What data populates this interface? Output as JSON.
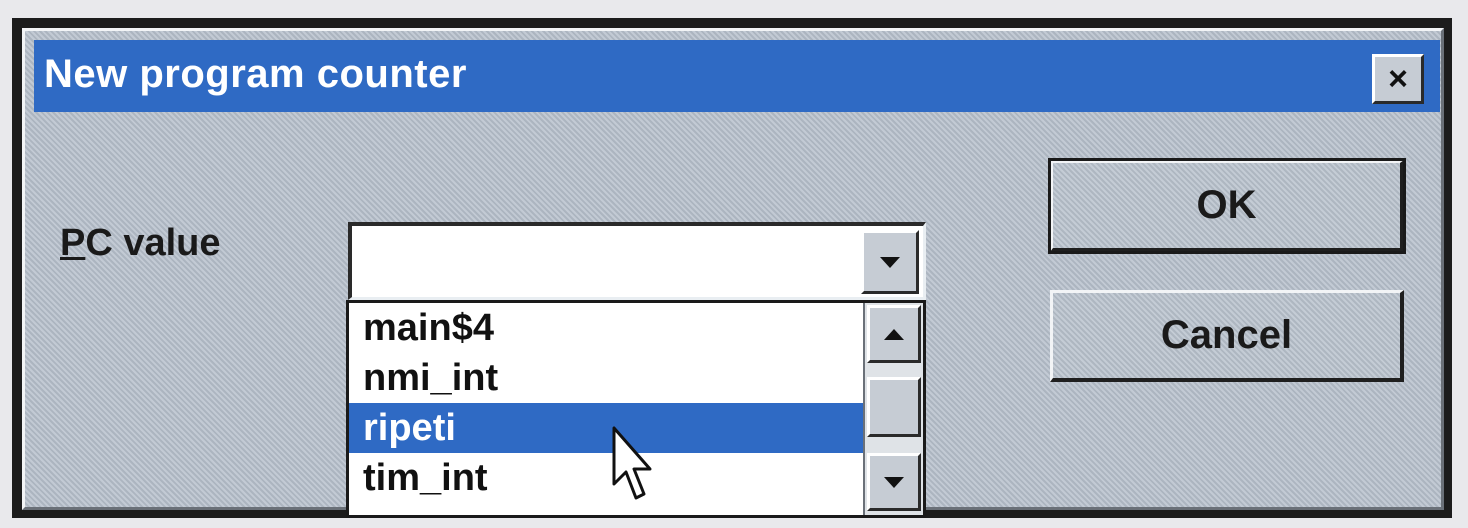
{
  "dialog": {
    "title": "New program counter",
    "close_symbol": "×"
  },
  "form": {
    "pc_label_mnemonic": "P",
    "pc_label_rest": "C value",
    "combo_value": ""
  },
  "dropdown": {
    "items": [
      {
        "label": "main$4",
        "selected": false
      },
      {
        "label": "nmi_int",
        "selected": false
      },
      {
        "label": "ripeti",
        "selected": true
      },
      {
        "label": "tim_int",
        "selected": false
      }
    ]
  },
  "buttons": {
    "ok_label": "OK",
    "cancel_label": "Cancel"
  },
  "icons": {
    "close": "close-icon",
    "combo_arrow": "chevron-down-icon",
    "scroll_up": "scroll-up-icon",
    "scroll_down": "scroll-down-icon",
    "cursor": "mouse-pointer-icon"
  },
  "colors": {
    "titlebar": "#2f6ac4",
    "selection": "#2f6ac4",
    "dialog_bg": "#b7c0cc"
  }
}
